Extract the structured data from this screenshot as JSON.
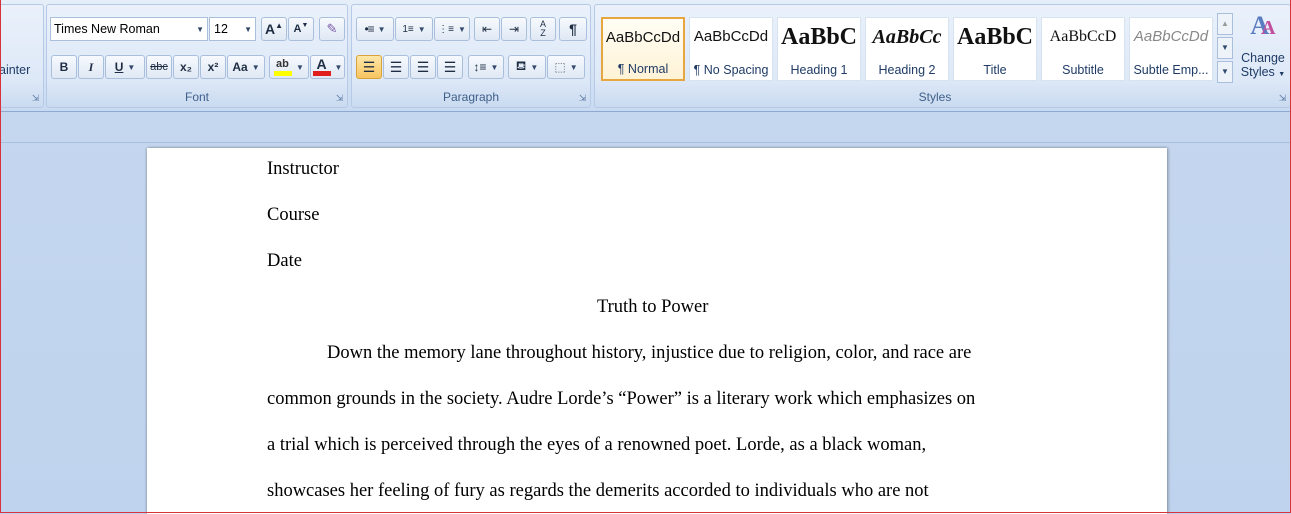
{
  "clipboard": {
    "format_painter_fragment": "ainter"
  },
  "font_group": {
    "label": "Font",
    "font_name": "Times New Roman",
    "font_size": "12",
    "grow_font": "A",
    "shrink_font": "A",
    "bold": "B",
    "italic": "I",
    "underline": "U",
    "strikethrough": "abc",
    "subscript": "x₂",
    "superscript": "x²",
    "change_case": "Aa",
    "font_color_glyph": "A",
    "highlight_glyph": "ab",
    "highlight_color": "#ffff00",
    "font_color": "#e01e1e"
  },
  "paragraph_group": {
    "label": "Paragraph",
    "show_marks": "¶"
  },
  "styles_group": {
    "label": "Styles",
    "tiles": [
      {
        "sample": "AaBbCcDd",
        "name": "¶ Normal"
      },
      {
        "sample": "AaBbCcDd",
        "name": "¶ No Spacing"
      },
      {
        "sample": "AaBbC",
        "name": "Heading 1"
      },
      {
        "sample": "AaBbCc",
        "name": "Heading 2"
      },
      {
        "sample": "AaBbC",
        "name": "Title"
      },
      {
        "sample": "AaBbCcD",
        "name": "Subtitle"
      },
      {
        "sample": "AaBbCcDd",
        "name": "Subtle Emp..."
      }
    ],
    "change_styles_line1": "Change",
    "change_styles_line2": "Styles"
  },
  "document": {
    "header_lines": [
      "Instructor",
      "Course",
      "Date"
    ],
    "title": "Truth to Power",
    "body_lines": [
      "Down the memory lane throughout history, injustice due to religion, color, and race are",
      "common grounds in the society. Audre Lorde’s “Power” is a literary work which emphasizes on",
      "a trial which is perceived through the eyes of a renowned poet. Lorde, as a black woman,",
      "showcases her feeling of fury as regards the demerits accorded to individuals who are not"
    ]
  }
}
